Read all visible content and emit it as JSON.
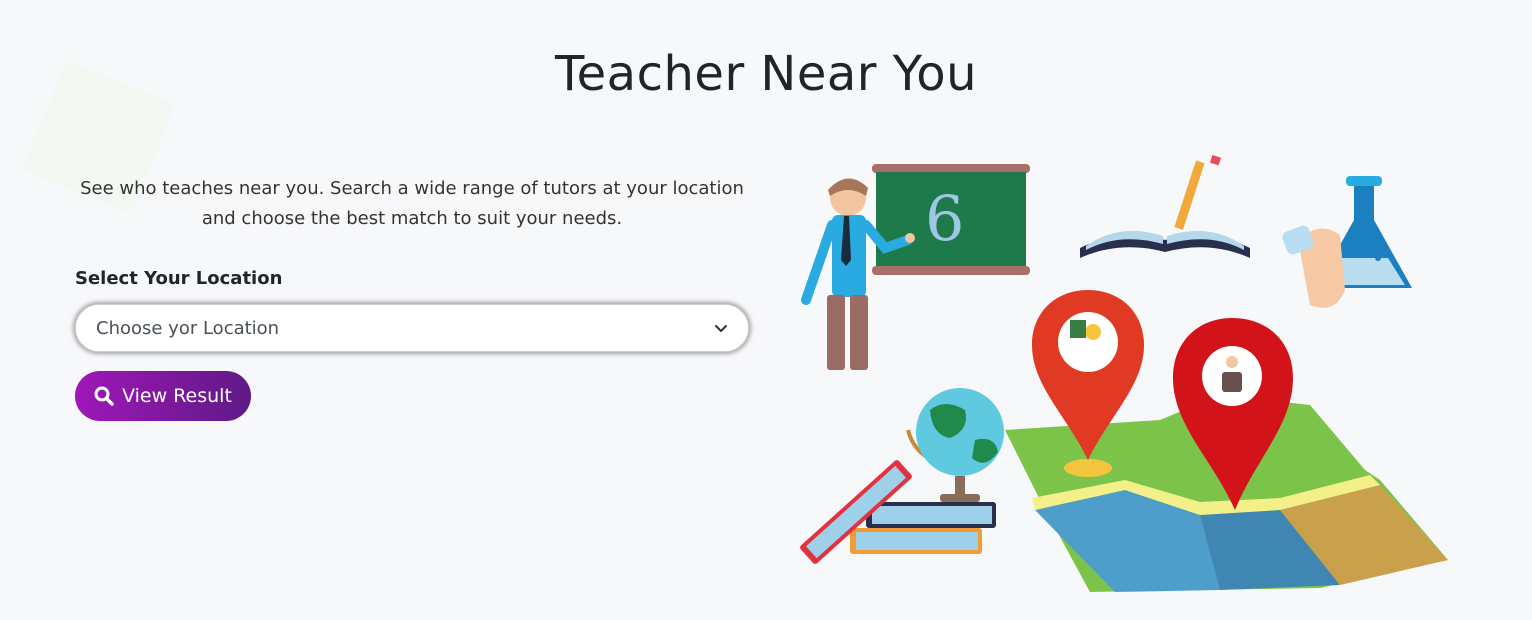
{
  "page": {
    "title": "Teacher Near You",
    "intro": "See who teaches near you. Search a wide range of tutors at your location and choose the best match to suit your needs."
  },
  "location": {
    "label": "Select Your Location",
    "selected": "Choose yor Location"
  },
  "actions": {
    "view_result": "View Result"
  },
  "colors": {
    "background": "#f7f8fa",
    "button_start": "#a017b8",
    "button_end": "#5e1a86",
    "chalkboard": "#1e7a4a",
    "pin": "#e03a25"
  },
  "illustration": {
    "board_text": "6",
    "icons": [
      "teacher-figure",
      "chalkboard",
      "open-book",
      "pencil",
      "flask",
      "globe",
      "book-stack",
      "map",
      "location-pin"
    ]
  }
}
